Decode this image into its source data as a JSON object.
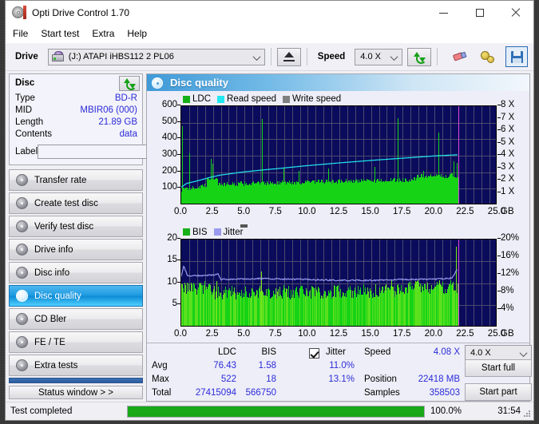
{
  "window": {
    "title": "Opti Drive Control 1.70",
    "icon": "disc-icon",
    "minimize": "—",
    "maximize": "□",
    "close": "×"
  },
  "menu": {
    "items": [
      "File",
      "Start test",
      "Extra",
      "Help"
    ]
  },
  "toolbar": {
    "drive_label": "Drive",
    "drive_value": "(J:)  ATAPI iHBS112  2 PL06",
    "eject_icon": "eject-icon",
    "speed_label": "Speed",
    "speed_value": "4.0 X",
    "refresh_icon": "refresh-icon",
    "eraser_icon": "eraser-icon",
    "settings_icon": "gear-icon",
    "save_icon": "floppy-disk-icon"
  },
  "disc_panel": {
    "title": "Disc",
    "refresh_icon": "refresh-icon",
    "rows": [
      {
        "key": "Type",
        "value": "BD-R"
      },
      {
        "key": "MID",
        "value": "MBIR06 (000)"
      },
      {
        "key": "Length",
        "value": "21.89 GB"
      },
      {
        "key": "Contents",
        "value": "data"
      }
    ],
    "label_key": "Label",
    "label_value": "",
    "label_placeholder": "",
    "cd_icon": "cd-icon"
  },
  "nav": {
    "items": [
      {
        "label": "Transfer rate",
        "active": false
      },
      {
        "label": "Create test disc",
        "active": false
      },
      {
        "label": "Verify test disc",
        "active": false
      },
      {
        "label": "Drive info",
        "active": false
      },
      {
        "label": "Disc info",
        "active": false
      },
      {
        "label": "Disc quality",
        "active": true
      },
      {
        "label": "CD Bler",
        "active": false
      },
      {
        "label": "FE / TE",
        "active": false
      },
      {
        "label": "Extra tests",
        "active": false
      }
    ],
    "status_window": "Status window > >"
  },
  "content": {
    "title": "Disc quality",
    "icon": "disc-quality-icon"
  },
  "chart_data": [
    {
      "type": "area",
      "name": "ldc-chart",
      "title": "",
      "xlabel": "GB",
      "ylabel": "",
      "legend": [
        {
          "label": "LDC",
          "color": "#18b018"
        },
        {
          "label": "Read speed",
          "color": "#22e8f0"
        },
        {
          "label": "Write speed",
          "color": "#808080"
        }
      ],
      "legend_position": "top-left",
      "grid": true,
      "xlim": [
        0.0,
        25.0
      ],
      "xticks": [
        "0.0",
        "2.5",
        "5.0",
        "7.5",
        "10.0",
        "12.5",
        "15.0",
        "17.5",
        "20.0",
        "22.5",
        "25.0"
      ],
      "x_unit": "GB",
      "ylim": [
        0,
        600
      ],
      "yticks": [
        "600",
        "500",
        "400",
        "300",
        "200",
        "100"
      ],
      "y2label": "X",
      "y2lim": [
        0,
        8
      ],
      "y2ticks": [
        "8 X",
        "7 X",
        "6 X",
        "5 X",
        "4 X",
        "3 X",
        "2 X",
        "1 X"
      ],
      "data_end_gb": 21.89,
      "series": [
        {
          "name": "LDC",
          "color": "#16d316",
          "axis": "left",
          "baseline_from": 110,
          "baseline_to": 150,
          "noise": 28,
          "spikes": [
            [
              0.05,
              470
            ],
            [
              0.6,
              305
            ],
            [
              2.35,
              270
            ],
            [
              2.45,
              240
            ],
            [
              6.35,
              515
            ],
            [
              8.1,
              215
            ],
            [
              9.3,
              200
            ],
            [
              11.6,
              215
            ],
            [
              15.3,
              225
            ],
            [
              17.1,
              520
            ],
            [
              19.1,
              200
            ],
            [
              20.3,
              430
            ],
            [
              21.5,
              255
            ],
            [
              21.8,
              245
            ]
          ]
        },
        {
          "name": "Read speed",
          "color": "#22e8f0",
          "axis": "right",
          "points": [
            [
              0.0,
              1.45
            ],
            [
              0.4,
              1.75
            ],
            [
              1.2,
              1.95
            ],
            [
              2.3,
              2.25
            ],
            [
              3.0,
              2.42
            ],
            [
              5.0,
              2.7
            ],
            [
              7.5,
              2.95
            ],
            [
              10.0,
              3.2
            ],
            [
              12.5,
              3.42
            ],
            [
              15.0,
              3.62
            ],
            [
              17.5,
              3.8
            ],
            [
              20.0,
              3.98
            ],
            [
              21.9,
              4.08
            ]
          ]
        },
        {
          "name": "Write speed",
          "color": "#808080",
          "axis": "right",
          "points": []
        }
      ],
      "marker_line_gb": 21.9,
      "marker_color": "#e048e0"
    },
    {
      "type": "area",
      "name": "bis-jitter-chart",
      "title": "",
      "xlabel": "GB",
      "legend": [
        {
          "label": "BIS",
          "color": "#18b018"
        },
        {
          "label": "Jitter",
          "color": "#9a9aee"
        }
      ],
      "legend_position": "top-left",
      "grid": true,
      "xlim": [
        0.0,
        25.0
      ],
      "xticks": [
        "0.0",
        "2.5",
        "5.0",
        "7.5",
        "10.0",
        "12.5",
        "15.0",
        "17.5",
        "20.0",
        "22.5",
        "25.0"
      ],
      "x_unit": "GB",
      "ylim": [
        0,
        20
      ],
      "yticks": [
        "20",
        "15",
        "10",
        "5"
      ],
      "y2lim": [
        0,
        20
      ],
      "y2ticks": [
        "20%",
        "16%",
        "12%",
        "8%",
        "4%"
      ],
      "data_end_gb": 21.89,
      "series": [
        {
          "name": "BIS",
          "color": "#7ce815",
          "axis": "left",
          "baseline_from": 7.2,
          "baseline_to": 7.8,
          "noise": 3.2,
          "spikes": [
            [
              2.8,
              10.2
            ],
            [
              6.3,
              12.3
            ],
            [
              16.6,
              10.3
            ],
            [
              18.5,
              10.2
            ],
            [
              20.4,
              10.4
            ],
            [
              21.7,
              18.0
            ]
          ]
        },
        {
          "name": "Jitter",
          "color": "#9a9aee",
          "axis": "left_pct",
          "points": [
            [
              0.0,
              11.7
            ],
            [
              0.2,
              14.0
            ],
            [
              0.5,
              11.7
            ],
            [
              2.6,
              11.9
            ],
            [
              2.9,
              12.3
            ],
            [
              3.1,
              10.9
            ],
            [
              6.3,
              11.1
            ],
            [
              10.0,
              10.9
            ],
            [
              12.5,
              10.7
            ],
            [
              15.0,
              10.7
            ],
            [
              17.5,
              10.9
            ],
            [
              20.0,
              11.0
            ],
            [
              21.4,
              11.2
            ],
            [
              21.8,
              13.1
            ]
          ]
        }
      ],
      "marker_line_gb": 21.9,
      "marker_color": "#e048e0"
    }
  ],
  "stats": {
    "col_headers": [
      "LDC",
      "BIS"
    ],
    "row_labels": [
      "Avg",
      "Max",
      "Total"
    ],
    "ldc": {
      "avg": "76.43",
      "max": "522",
      "total": "27415094"
    },
    "bis": {
      "avg": "1.58",
      "max": "18",
      "total": "566750"
    },
    "jitter": {
      "label": "Jitter",
      "checked": true,
      "avg": "11.0%",
      "max": "13.1%"
    },
    "speed_label": "Speed",
    "speed_value": "4.08 X",
    "position_label": "Position",
    "position_value": "22418 MB",
    "samples_label": "Samples",
    "samples_value": "358503",
    "speed_select": "4.0 X",
    "start_full": "Start full",
    "start_part": "Start part"
  },
  "statusbar": {
    "message": "Test completed",
    "progress_percent": "100.0%",
    "progress_value": 100,
    "elapsed": "31:54"
  }
}
